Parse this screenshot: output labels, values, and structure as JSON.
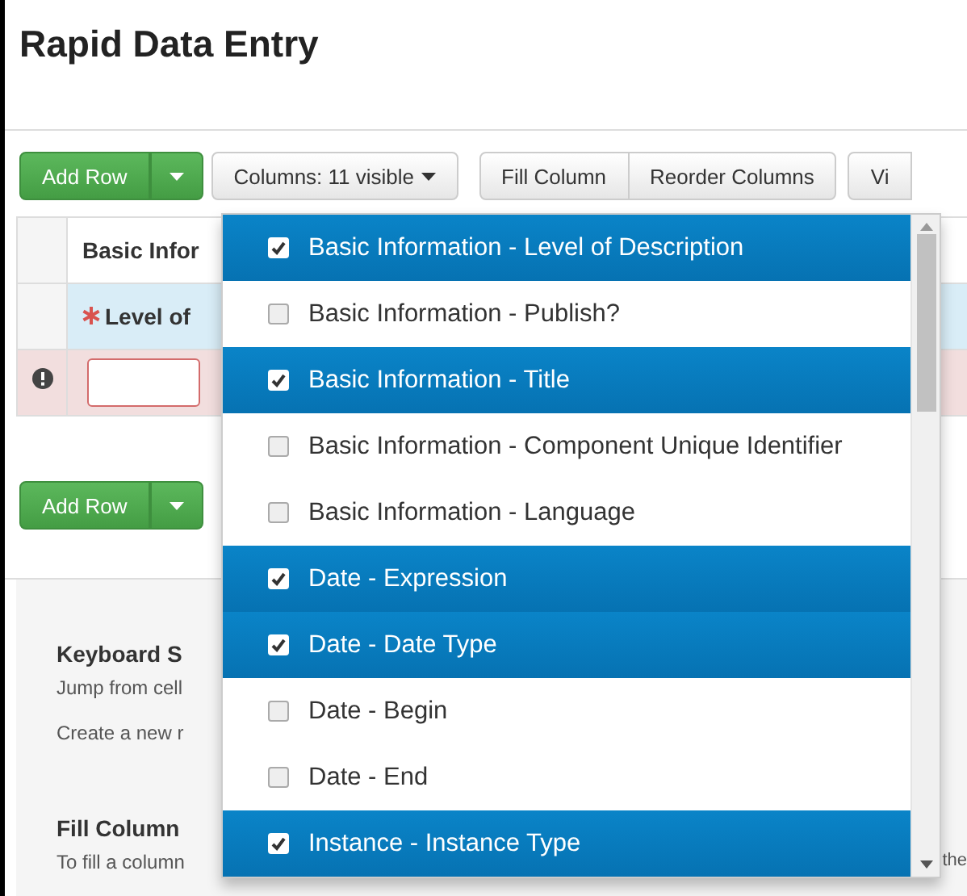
{
  "title": "Rapid Data Entry",
  "toolbar": {
    "add_row": "Add Row",
    "columns_button": "Columns: 11 visible",
    "buttons": [
      "Fill Column",
      "Reorder Columns",
      "Vi"
    ]
  },
  "table": {
    "group_header": "Basic Infor",
    "column_header": {
      "label": "Level of",
      "required": true
    },
    "rows": [
      {
        "error": true
      }
    ]
  },
  "bottom_add_row": "Add Row",
  "help": {
    "sections": [
      {
        "heading": "Keyboard S",
        "lines": [
          "Jump from cell",
          "Create a new r"
        ]
      },
      {
        "heading": "Fill Column",
        "lines": [
          "To fill a column"
        ]
      }
    ],
    "column_2": "the"
  },
  "column_menu": {
    "items": [
      {
        "label": "Basic Information - Level of Description",
        "checked": true
      },
      {
        "label": "Basic Information - Publish?",
        "checked": false
      },
      {
        "label": "Basic Information - Title",
        "checked": true
      },
      {
        "label": "Basic Information - Component Unique Identifier",
        "checked": false
      },
      {
        "label": "Basic Information - Language",
        "checked": false
      },
      {
        "label": "Date - Expression",
        "checked": true
      },
      {
        "label": "Date - Date Type",
        "checked": true
      },
      {
        "label": "Date - Begin",
        "checked": false
      },
      {
        "label": "Date - End",
        "checked": false
      },
      {
        "label": "Instance - Instance Type",
        "checked": true
      }
    ]
  }
}
